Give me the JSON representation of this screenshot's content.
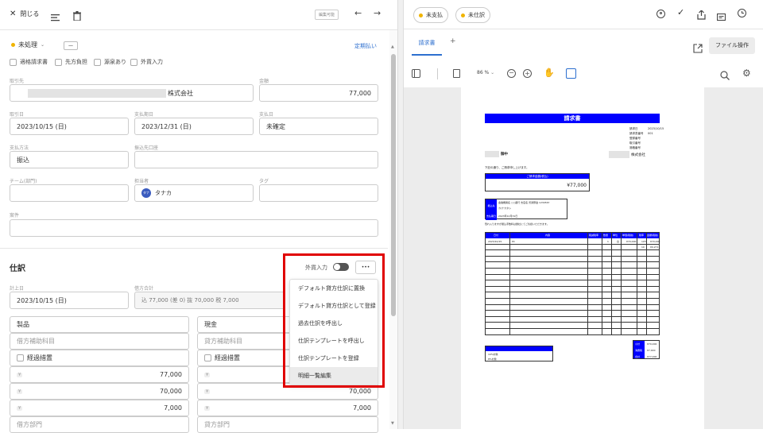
{
  "left_toolbar": {
    "close_label": "閉じる",
    "edit_badge": "編集可能"
  },
  "status": {
    "label": "未処理",
    "extra": "—"
  },
  "schedule_link": "定期払い",
  "checkboxes": [
    "適格請求書",
    "先方負担",
    "源泉あり",
    "外貨入力"
  ],
  "fields": {
    "partner_label": "取引先",
    "partner_value": "株式会社",
    "amount_label": "金額",
    "amount_value": "77,000",
    "txn_date_label": "取引日",
    "txn_date_value": "2023/10/15 (日)",
    "due_date_label": "支払期日",
    "due_date_value": "2023/12/31 (日)",
    "pay_date_label": "支払日",
    "pay_date_value": "未確定",
    "pay_method_label": "支払方法",
    "pay_method_value": "振込",
    "pay_account_label": "振込先口座",
    "team_label": "チーム(部門)",
    "owner_label": "担当者",
    "owner_value": "タナカ",
    "owner_initials": "タナ",
    "tag_label": "タグ",
    "memo_label": "案件"
  },
  "journal": {
    "title": "仕訳",
    "foreign_toggle_label": "外貨入力",
    "more_label": "•••",
    "post_date_label": "計上日",
    "post_date_value": "2023/10/15 (日)",
    "debit_total_label": "借方合計",
    "debit_total_value": "込 77,000 (差 0)  抜 70,000  税 7,000",
    "debit_account": "製品",
    "debit_sub_ph": "借方補助科目",
    "debit_interim": "経過措置",
    "debit_amounts": [
      "77,000",
      "70,000",
      "7,000"
    ],
    "debit_dept_ph": "借方部門",
    "credit_account": "現金",
    "credit_sub_ph": "貸方補助科目",
    "credit_interim": "経過措置",
    "credit_amounts": [
      "70,000",
      "7,000"
    ],
    "credit_dept_ph": "貸方部門",
    "row_icon": "¥"
  },
  "dropdown_menu": [
    "デフォルト貸方仕訳に置換",
    "デフォルト貸方仕訳として登録",
    "過去仕訳を呼出し",
    "仕訳テンプレートを呼出し",
    "仕訳テンプレートを登録",
    "明細一覧編集"
  ],
  "right_header": {
    "pills": [
      "未支払",
      "未仕訳"
    ]
  },
  "doc_tabs": {
    "active": "請求書",
    "add": "+",
    "file_ops": "ファイル操作"
  },
  "viewer": {
    "zoom": "86 %"
  },
  "invoice": {
    "title": "請求書",
    "meta_labels": [
      "請求日",
      "請求書番号",
      "登録番号",
      "取引番号",
      "適格番号"
    ],
    "meta_values": [
      "2023/10/15",
      "001",
      "",
      "",
      ""
    ],
    "to": "御中",
    "from": "株式会社",
    "greeting": "下記の通り、ご請求申し上げます。",
    "amount_box_title": "ご請求金額(税込)",
    "amount_box_value": "¥77,000",
    "bank_label": "振込先",
    "bank_line1": "金融機関名 ○○銀行 支店名 普通預金 1234567",
    "bank_line2": "カ)ナカタシ",
    "due_label": "支払期日",
    "due_value": "2023年12月31日",
    "note": "恐れ入りますが振込手数料は貴社にてご負担いただきます。",
    "columns": [
      "日付",
      "内容",
      "軽減税率",
      "数量",
      "単位",
      "単価(税抜)",
      "税率",
      "金額(税抜)"
    ],
    "row1": [
      "2023/10/15",
      "PC",
      "",
      "1",
      "台",
      "¥70,000",
      "10%",
      "¥70,000"
    ],
    "side_values": [
      "10",
      "¥0,271"
    ],
    "summary_labels": [
      "小計",
      "消費税",
      "合計"
    ],
    "summary_values": [
      "¥70,000",
      "¥7,000",
      "¥77,000"
    ],
    "tax_rows": [
      "10%対象",
      "8%対象"
    ]
  }
}
